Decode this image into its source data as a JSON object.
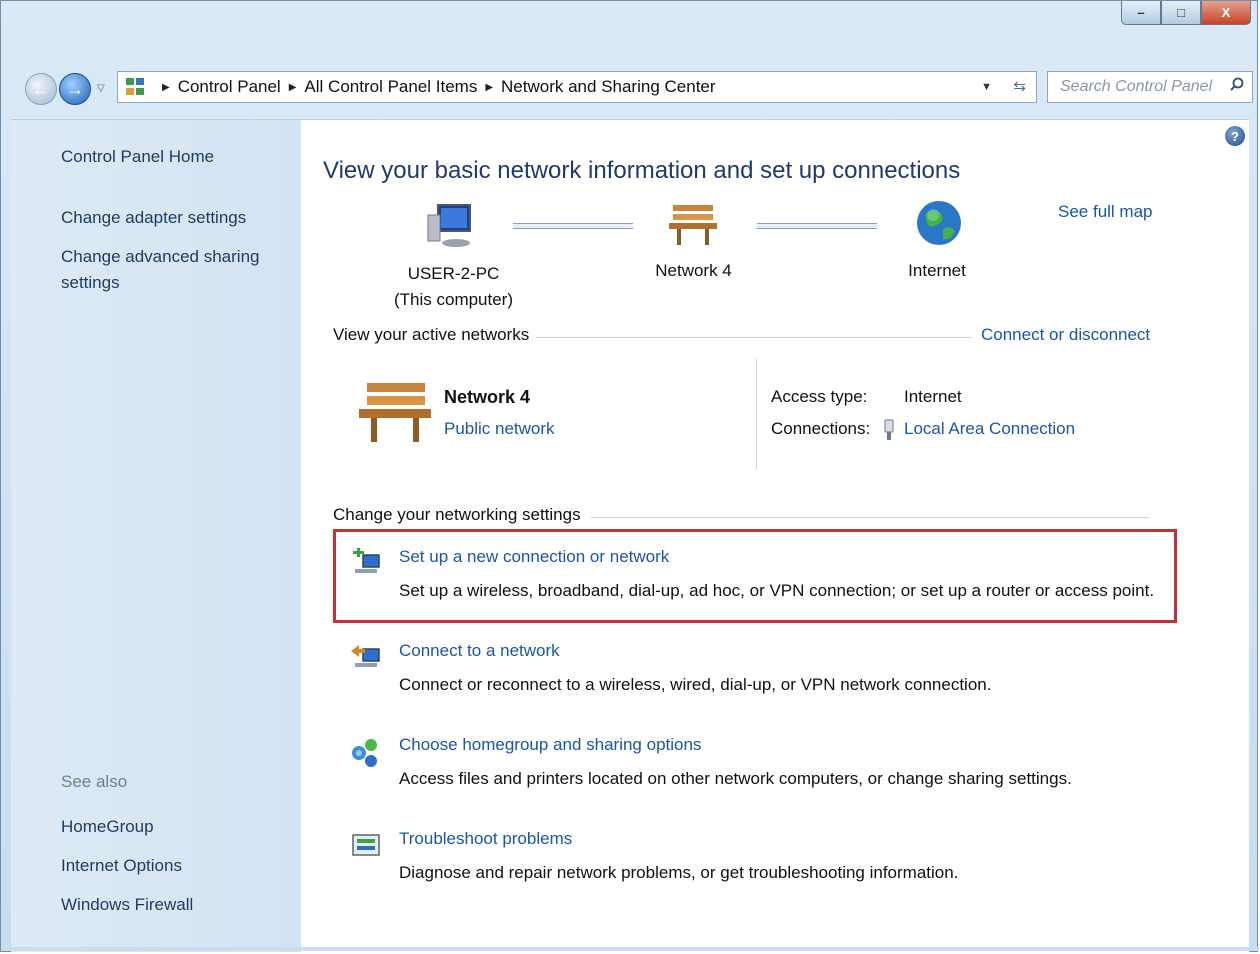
{
  "window": {
    "minimize_label": "–",
    "maximize_label": "□",
    "close_label": "X"
  },
  "nav": {
    "breadcrumbs": [
      "Control Panel",
      "All Control Panel Items",
      "Network and Sharing Center"
    ],
    "search_placeholder": "Search Control Panel"
  },
  "sidebar": {
    "items": [
      {
        "label": "Control Panel Home"
      },
      {
        "label": "Change adapter settings"
      },
      {
        "label": "Change advanced sharing settings"
      }
    ],
    "see_also_label": "See also",
    "see_also_items": [
      {
        "label": "HomeGroup"
      },
      {
        "label": "Internet Options"
      },
      {
        "label": "Windows Firewall"
      }
    ]
  },
  "main": {
    "title": "View your basic network information and set up connections",
    "see_full_map": "See full map",
    "map": {
      "computer_name": "USER-2-PC",
      "computer_sub": "(This computer)",
      "network_name": "Network 4",
      "internet_label": "Internet"
    },
    "active_networks": {
      "section_label": "View your active networks",
      "connect_link": "Connect or disconnect",
      "network_name": "Network 4",
      "network_type": "Public network",
      "access_type_label": "Access type:",
      "access_type_value": "Internet",
      "connections_label": "Connections:",
      "connections_value": "Local Area Connection"
    },
    "change_settings": {
      "section_label": "Change your networking settings",
      "tasks": [
        {
          "title": "Set up a new connection or network",
          "desc": "Set up a wireless, broadband, dial-up, ad hoc, or VPN connection; or set up a router or access point."
        },
        {
          "title": "Connect to a network",
          "desc": "Connect or reconnect to a wireless, wired, dial-up, or VPN network connection."
        },
        {
          "title": "Choose homegroup and sharing options",
          "desc": "Access files and printers located on other network computers, or change sharing settings."
        },
        {
          "title": "Troubleshoot problems",
          "desc": "Diagnose and repair network problems, or get troubleshooting information."
        }
      ]
    }
  },
  "colors": {
    "link": "#1a56a8",
    "highlight_border": "#c2323c",
    "sidebar_bg": "#d3e3f3"
  }
}
